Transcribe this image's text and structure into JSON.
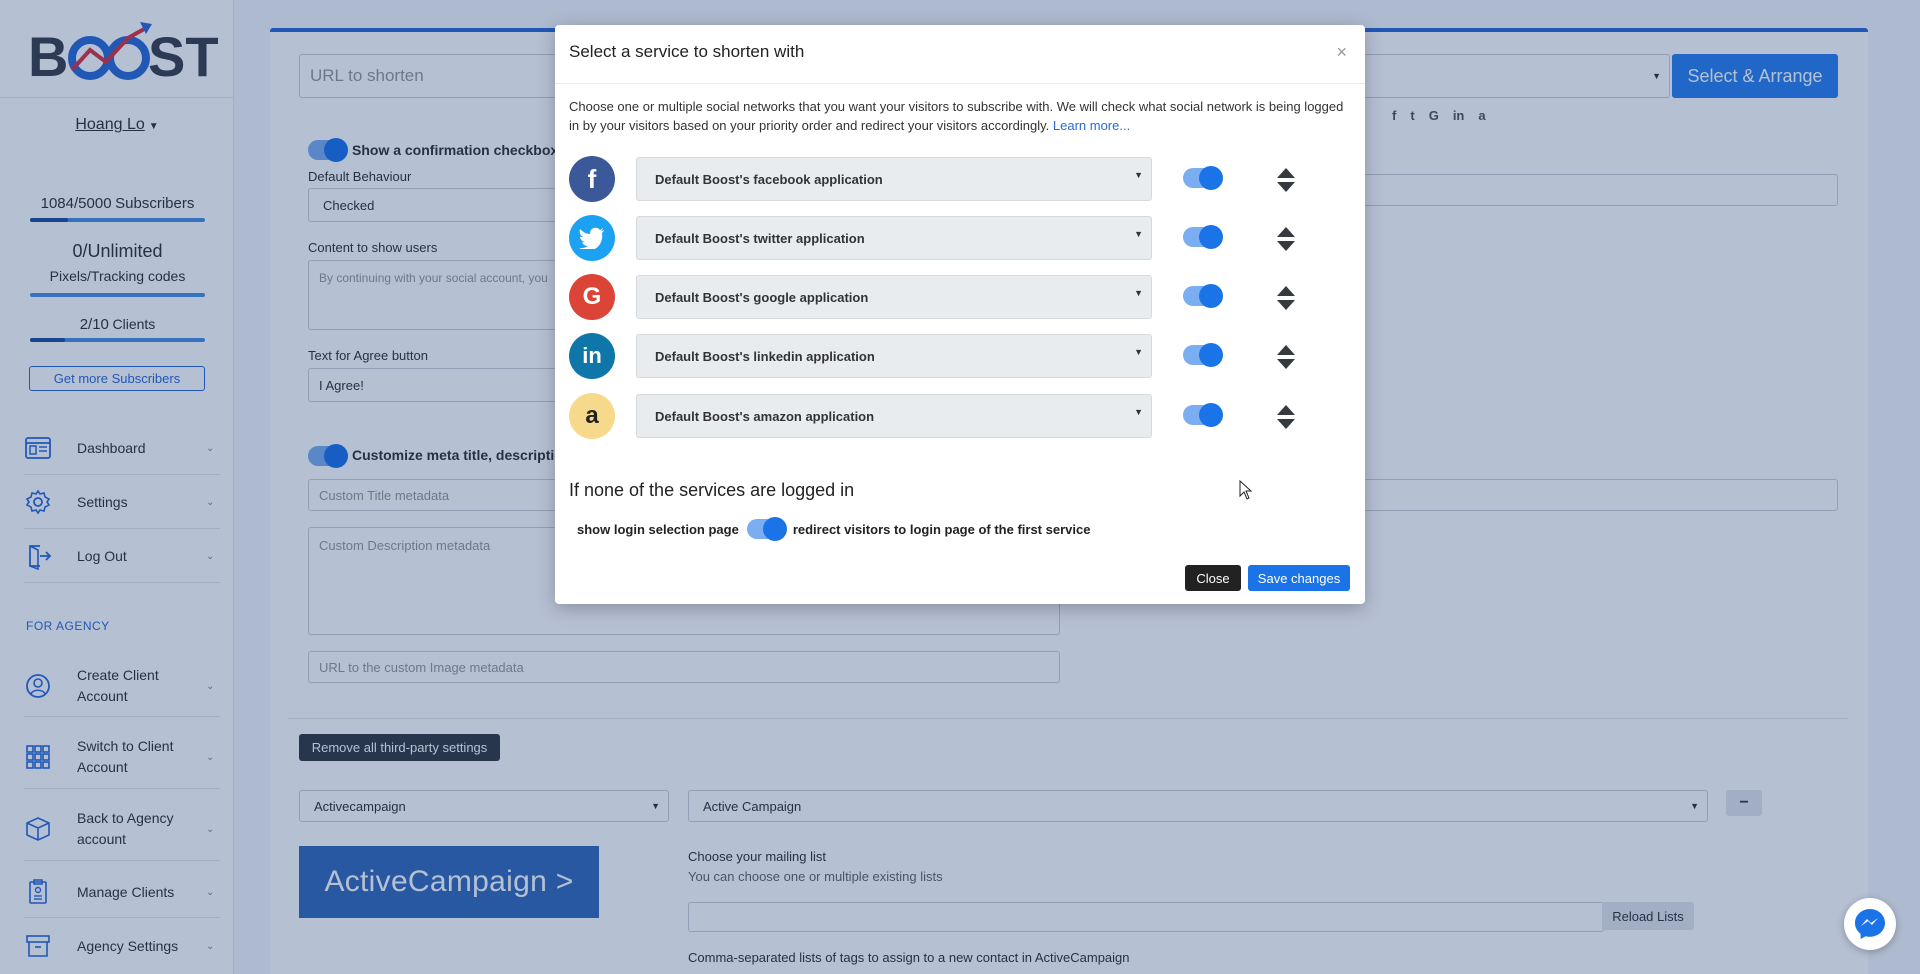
{
  "sidebar": {
    "logo_text": "BOOST",
    "username": "Hoang Lo",
    "subscribers": {
      "count": "1084/5000",
      "label": "Subscribers",
      "progress": 0.2168
    },
    "pixels": {
      "count": "0/Unlimited",
      "label": "Pixels/Tracking codes",
      "progress": 0.0
    },
    "clients": {
      "count": "2/10",
      "label": "Clients",
      "progress": 0.2
    },
    "get_more_label": "Get more Subscribers",
    "nav": [
      {
        "label": "Dashboard",
        "icon": "dashboard-icon"
      },
      {
        "label": "Settings",
        "icon": "gear-icon"
      },
      {
        "label": "Log Out",
        "icon": "logout-icon"
      }
    ],
    "section_label": "FOR AGENCY",
    "agency_nav": [
      {
        "label": "Create Client Account",
        "icon": "user-circle-icon"
      },
      {
        "label": "Switch to Client Account",
        "icon": "grid-icon"
      },
      {
        "label": "Back to Agency account",
        "icon": "box-icon"
      },
      {
        "label": "Manage Clients",
        "icon": "clipboard-icon"
      },
      {
        "label": "Agency Settings",
        "icon": "archive-icon"
      }
    ]
  },
  "main": {
    "url_placeholder": "URL to shorten",
    "select_arrange_label": "Select & Arrange",
    "confirm_checkbox_label": "Show a confirmation checkbox to",
    "default_behaviour_label": "Default Behaviour",
    "default_behaviour_value": "Checked",
    "content_label": "Content to show users",
    "content_placeholder": "By continuing with your social account, you",
    "agree_label": "Text for Agree button",
    "agree_value": "I Agree!",
    "meta_label": "Customize meta title, description",
    "meta_title_placeholder": "Custom Title metadata",
    "meta_desc_placeholder": "Custom Description metadata",
    "meta_image_placeholder": "URL to the custom Image metadata",
    "remove_button": "Remove all third-party settings",
    "provider_select": "Activecampaign",
    "provider_account_select": "Active Campaign",
    "minus_label": "−",
    "ac_logo_text": "ActiveCampaign",
    "mailing_list_label": "Choose your mailing list",
    "mailing_list_help": "You can choose one or multiple existing lists",
    "reload_lists": "Reload Lists",
    "tags_label": "Comma-separated lists of tags to assign to a new contact in ActiveCampaign",
    "social_icons": [
      "f",
      "t",
      "G",
      "in",
      "a"
    ]
  },
  "modal": {
    "title": "Select a service to shorten with",
    "close_glyph": "×",
    "description": "Choose one or multiple social networks that you want your visitors to subscribe with. We will check what social network is being logged in by your visitors based on your priority order and redirect your visitors accordingly.",
    "learn_more": "Learn more...",
    "services": [
      {
        "name": "facebook",
        "icon_text": "f",
        "color": "#3b5998",
        "label": "Default Boost's facebook application",
        "enabled": true
      },
      {
        "name": "twitter",
        "icon_text": "t",
        "color": "#1da1f2",
        "label": "Default Boost's twitter application",
        "enabled": true
      },
      {
        "name": "google",
        "icon_text": "G",
        "color": "#db4437",
        "label": "Default Boost's google application",
        "enabled": true
      },
      {
        "name": "linkedin",
        "icon_text": "in",
        "color": "#0e76a8",
        "label": "Default Boost's linkedin application",
        "enabled": true
      },
      {
        "name": "amazon",
        "icon_text": "a",
        "color": "#f7d98b",
        "label": "Default Boost's amazon application",
        "enabled": true
      }
    ],
    "fallback_heading": "If none of the services are logged in",
    "fallback_left": "show login selection page",
    "fallback_right": "redirect visitors to login page of the first service",
    "close_button": "Close",
    "save_button": "Save changes"
  },
  "colors": {
    "accent": "#2a6bd6",
    "toggle_on": "#1b73e8",
    "dark_button": "#343a40"
  }
}
